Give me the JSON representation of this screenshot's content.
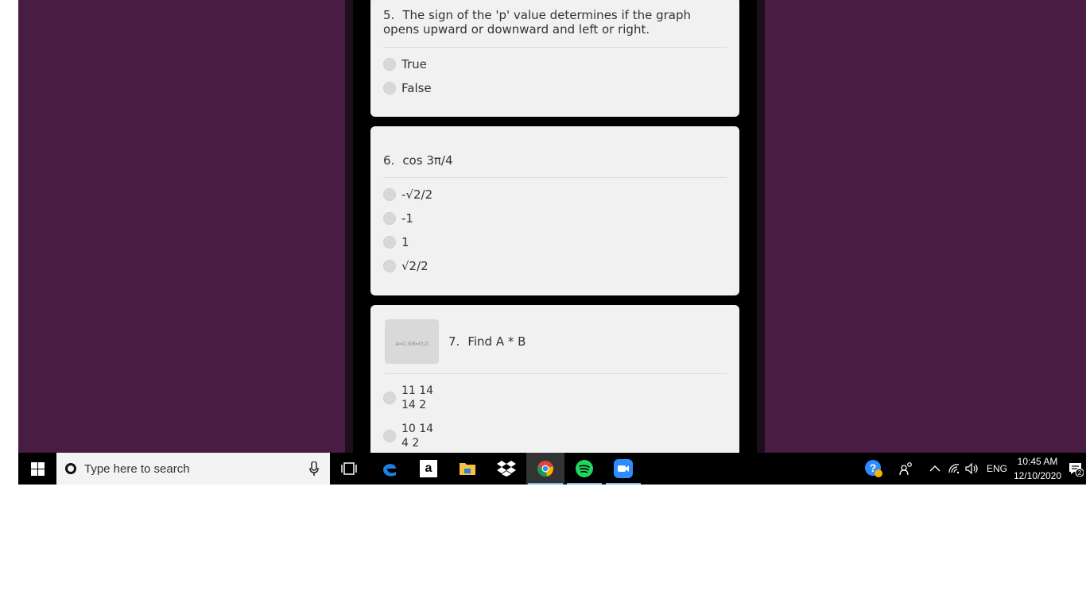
{
  "colors": {
    "background": "#481c43",
    "card": "#f1f1f1",
    "taskbar": "#000000",
    "search_box": "#f3f3f3",
    "active_underline": "#76b9ed"
  },
  "questions": [
    {
      "number": "5.",
      "text": "The sign of the 'p' value determines if the graph opens upward or downward and left or right.",
      "options": [
        "True",
        "False"
      ]
    },
    {
      "number": "6.",
      "text": "cos 3π/4",
      "options": [
        "-√2/2",
        "-1",
        "1",
        "√2/2"
      ]
    },
    {
      "number": "7.",
      "text": "Find A * B",
      "thumbnail_text": "A=[1 3] B=[3 2]",
      "options": [
        {
          "line1": "11 14",
          "line2": "14 2"
        },
        {
          "line1": "10 14",
          "line2": "4 2"
        }
      ]
    }
  ],
  "taskbar": {
    "search_placeholder": "Type here to search",
    "apps": [
      "start-icon",
      "task-view-icon",
      "edge-icon",
      "amazon-icon",
      "file-explorer-icon",
      "dropbox-icon",
      "chrome-icon",
      "spotify-icon",
      "zoom-icon"
    ],
    "language": "ENG",
    "time": "10:45 AM",
    "date": "12/10/2020",
    "notification_count": "2"
  }
}
